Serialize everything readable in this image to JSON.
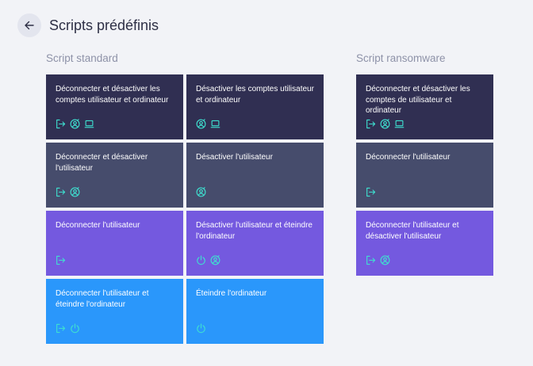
{
  "header": {
    "title": "Scripts prédéfinis"
  },
  "sections": {
    "standard": {
      "title": "Script standard",
      "cards": [
        {
          "label": "Déconnecter et désactiver les comptes utilisateur et ordinateur",
          "icons": [
            "logout-icon",
            "user-disabled-icon",
            "laptop-icon"
          ]
        },
        {
          "label": "Désactiver les comptes utilisateur et ordinateur",
          "icons": [
            "user-disabled-icon",
            "laptop-icon"
          ]
        },
        {
          "label": "Déconnecter et désactiver l'utilisateur",
          "icons": [
            "logout-icon",
            "user-disabled-icon"
          ]
        },
        {
          "label": "Désactiver l'utilisateur",
          "icons": [
            "user-disabled-icon"
          ]
        },
        {
          "label": "Déconnecter l'utilisateur",
          "icons": [
            "logout-icon"
          ]
        },
        {
          "label": "Désactiver l'utilisateur et éteindre l'ordinateur",
          "icons": [
            "power-icon",
            "user-disabled-icon"
          ]
        },
        {
          "label": "Déconnecter l'utilisateur et éteindre l'ordinateur",
          "icons": [
            "logout-icon",
            "power-icon"
          ]
        },
        {
          "label": "Éteindre l'ordinateur",
          "icons": [
            "power-icon"
          ]
        }
      ]
    },
    "ransomware": {
      "title": "Script ransomware",
      "cards": [
        {
          "label": "Déconnecter et désactiver les comptes de utilisateur et ordinateur",
          "icons": [
            "logout-icon",
            "user-disabled-icon",
            "laptop-icon"
          ]
        },
        {
          "label": "Déconnecter l'utilisateur",
          "icons": [
            "logout-icon"
          ]
        },
        {
          "label": "Déconnecter l'utilisateur et désactiver l'utilisateur",
          "icons": [
            "logout-icon",
            "user-disabled-icon"
          ]
        }
      ]
    }
  },
  "colors": {
    "card_dark": "#302f52",
    "card_slate": "#464c6c",
    "card_purple": "#7459df",
    "card_blue": "#2a97fb",
    "icon_accent": "#3ee0d0"
  }
}
